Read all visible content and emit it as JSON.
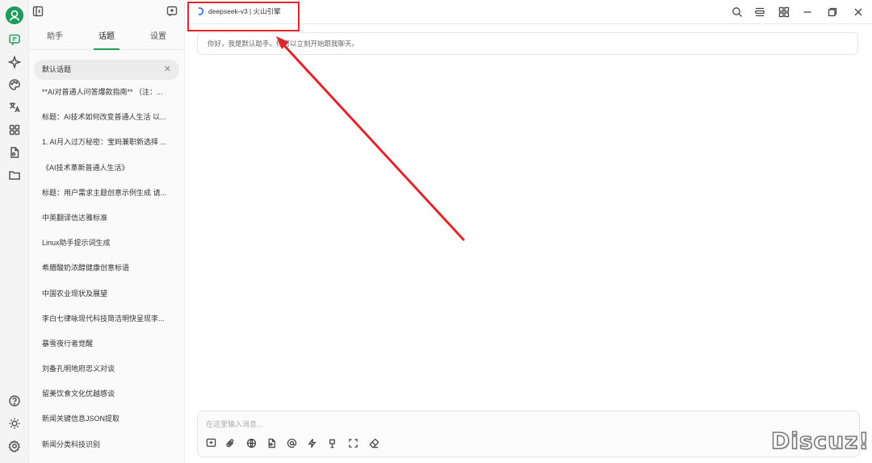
{
  "sidebar": {
    "tabs": [
      {
        "label": "助手"
      },
      {
        "label": "话题"
      },
      {
        "label": "设置"
      }
    ],
    "selected_topic": "默认话题",
    "topics": [
      "**AI对普通人问答爆款指南** （注：...",
      "标题：AI技术如何改变普通人生活 以...",
      "1. AI月入过万秘密：宝妈兼职新选择 ...",
      "《AI技术革新普通人生活》",
      "标题：用户需求主题创意示例生成 请...",
      "中英翻译信达雅标准",
      "Linux助手提示词生成",
      "希腊酸奶浓醇健康创意标语",
      "中国农业现状及展望",
      "李白七律咏现代科技简洁明快呈现李...",
      "暴雪夜行者觉醒",
      "刘备孔明地府忠义对谈",
      "留美饮食文化优越感谈",
      "新闻关键信息JSON提取",
      "新闻分类科技识别"
    ]
  },
  "header": {
    "model_label": "deepseek-v3 | 火山引擎"
  },
  "chat": {
    "greeting": "你好，我是默认助手。你可以立刻开始跟我聊天。"
  },
  "composer": {
    "placeholder": "在这里输入消息..."
  },
  "watermark": "Discuz!",
  "colors": {
    "accent": "#1f9c5a",
    "annotation": "#e0262b"
  }
}
